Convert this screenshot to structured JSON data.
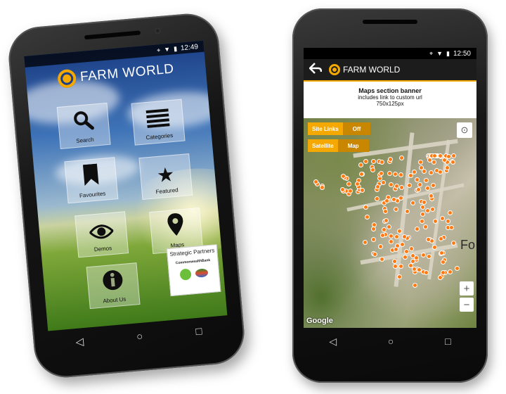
{
  "left_phone": {
    "status": {
      "time": "12:49",
      "icons": [
        "location-icon",
        "wifi-icon",
        "signal-icon",
        "battery-icon"
      ]
    },
    "app_title": "FARM WORLD",
    "tiles": [
      {
        "label": "Search",
        "icon": "search-icon"
      },
      {
        "label": "Categories",
        "icon": "list-icon"
      },
      {
        "label": "Favourites",
        "icon": "bookmark-icon"
      },
      {
        "label": "Featured",
        "icon": "star-icon"
      },
      {
        "label": "Demos",
        "icon": "eye-icon"
      },
      {
        "label": "Maps",
        "icon": "map-pin-icon"
      },
      {
        "label": "About Us",
        "icon": "info-icon"
      }
    ],
    "partners": {
      "heading": "Strategic Partners",
      "bank": "CommonwealthBank",
      "evergreen": "evergreen"
    },
    "nav": {
      "back": "◁",
      "home": "○",
      "recents": "□"
    }
  },
  "right_phone": {
    "status": {
      "time": "12:50"
    },
    "app_title": "FARM WORLD",
    "banner": {
      "title": "Maps section banner",
      "line2": "includes link to custom url",
      "line3": "750x125px"
    },
    "controls": [
      {
        "label": "Site Links",
        "value": "Off"
      },
      {
        "label": "Satellite",
        "value": "Map"
      }
    ],
    "zoom": {
      "in": "+",
      "out": "−"
    },
    "attribution": "Google",
    "map_label": "Fo",
    "nav": {
      "back": "◁",
      "home": "○",
      "recents": "□"
    }
  },
  "colors": {
    "accent": "#f5a800",
    "pin": "#ff7a12"
  }
}
